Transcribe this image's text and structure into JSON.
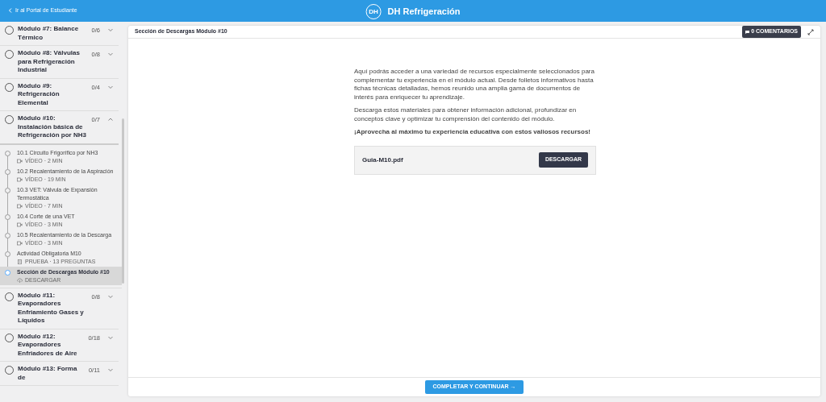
{
  "topbar": {
    "back_link": "Ir al Portal de Estudiante",
    "brand": "DH Refrigeración",
    "logo_text": "DH"
  },
  "sidebar": {
    "modules": [
      {
        "title": "Módulo #7: Balance Térmico",
        "count": "0/6",
        "expanded": false
      },
      {
        "title": "Módulo #8: Válvulas para Refrigeración Industrial",
        "count": "0/8",
        "expanded": false
      },
      {
        "title": "Módulo #9: Refrigeración Elemental",
        "count": "0/4",
        "expanded": false
      },
      {
        "title": "Módulo #10: Instalación básica de Refrigeración por NH3",
        "count": "0/7",
        "expanded": true,
        "lessons": [
          {
            "title": "10.1 Circuito Frigorífico por NH3",
            "kind": "video",
            "meta": "VÍDEO · 2 MIN",
            "selected": false
          },
          {
            "title": "10.2 Recalentamiento de la Aspiración",
            "kind": "video",
            "meta": "VÍDEO · 19 MIN",
            "selected": false
          },
          {
            "title": "10.3 VET: Válvula de Expansión Termostática",
            "kind": "video",
            "meta": "VÍDEO · 7 MIN",
            "selected": false
          },
          {
            "title": "10.4 Corte de una VET",
            "kind": "video",
            "meta": "VÍDEO · 3 MIN",
            "selected": false
          },
          {
            "title": "10.5 Recalentamiento de la Descarga",
            "kind": "video",
            "meta": "VÍDEO · 3 MIN",
            "selected": false
          },
          {
            "title": "Actividad Obligatoria M10",
            "kind": "quiz",
            "meta": "PRUEBA · 13 PREGUNTAS",
            "selected": false
          },
          {
            "title": "Sección de Descargas Módulo #10",
            "kind": "download",
            "meta": "DESCARGAR",
            "selected": true
          }
        ]
      },
      {
        "title": "Módulo #11: Evaporadores Enfriamiento Gases y Líquidos",
        "count": "0/8",
        "expanded": false
      },
      {
        "title": "Módulo #12: Evaporadores Enfriadores de Aire",
        "count": "0/18",
        "expanded": false
      },
      {
        "title": "Módulo #13: Forma de",
        "count": "0/11",
        "expanded": false
      }
    ]
  },
  "content": {
    "title": "Sección de Descargas Módulo #10",
    "comments": "0 COMENTARIOS",
    "paragraphs": [
      "Aquí podrás acceder a una variedad de recursos especialmente seleccionados para complementar tu experiencia en el módulo actual. Desde folletos informativos hasta fichas técnicas detalladas, hemos reunido una amplia gama de documentos de interés para enriquecer tu aprendizaje.",
      "Descarga estos materiales para obtener información adicional, profundizar en conceptos clave y optimizar tu comprensión del contenido del módulo.",
      "**¡Aprovecha al máximo tu experiencia educativa con estos valiosos recursos!**"
    ],
    "file": {
      "name": "Guia-M10.pdf",
      "button": "DESCARGAR"
    },
    "continue_button": "COMPLETAR Y CONTINUAR →"
  }
}
